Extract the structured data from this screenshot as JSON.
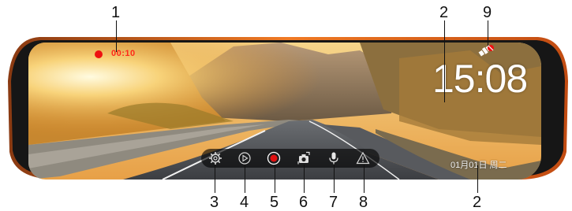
{
  "callouts": {
    "recording": "1",
    "clock": "2",
    "gps": "9",
    "settings": "3",
    "playback": "4",
    "record": "5",
    "camera_switch": "6",
    "microphone": "7",
    "warning": "8",
    "date": "2"
  },
  "status": {
    "recording_time": "00:10",
    "clock": "15:08",
    "date": "01月01日  周二"
  },
  "toolbar": {
    "buttons": [
      {
        "icon": "gear-icon"
      },
      {
        "icon": "play-icon"
      },
      {
        "icon": "record-icon"
      },
      {
        "icon": "camera-switch-icon"
      },
      {
        "icon": "microphone-icon"
      },
      {
        "icon": "warning-icon"
      }
    ]
  },
  "colors": {
    "record_red": "#e11111",
    "text_white": "#ffffff",
    "toolbar_bg": "#000000",
    "bezel_orange": "#e86a1c"
  }
}
